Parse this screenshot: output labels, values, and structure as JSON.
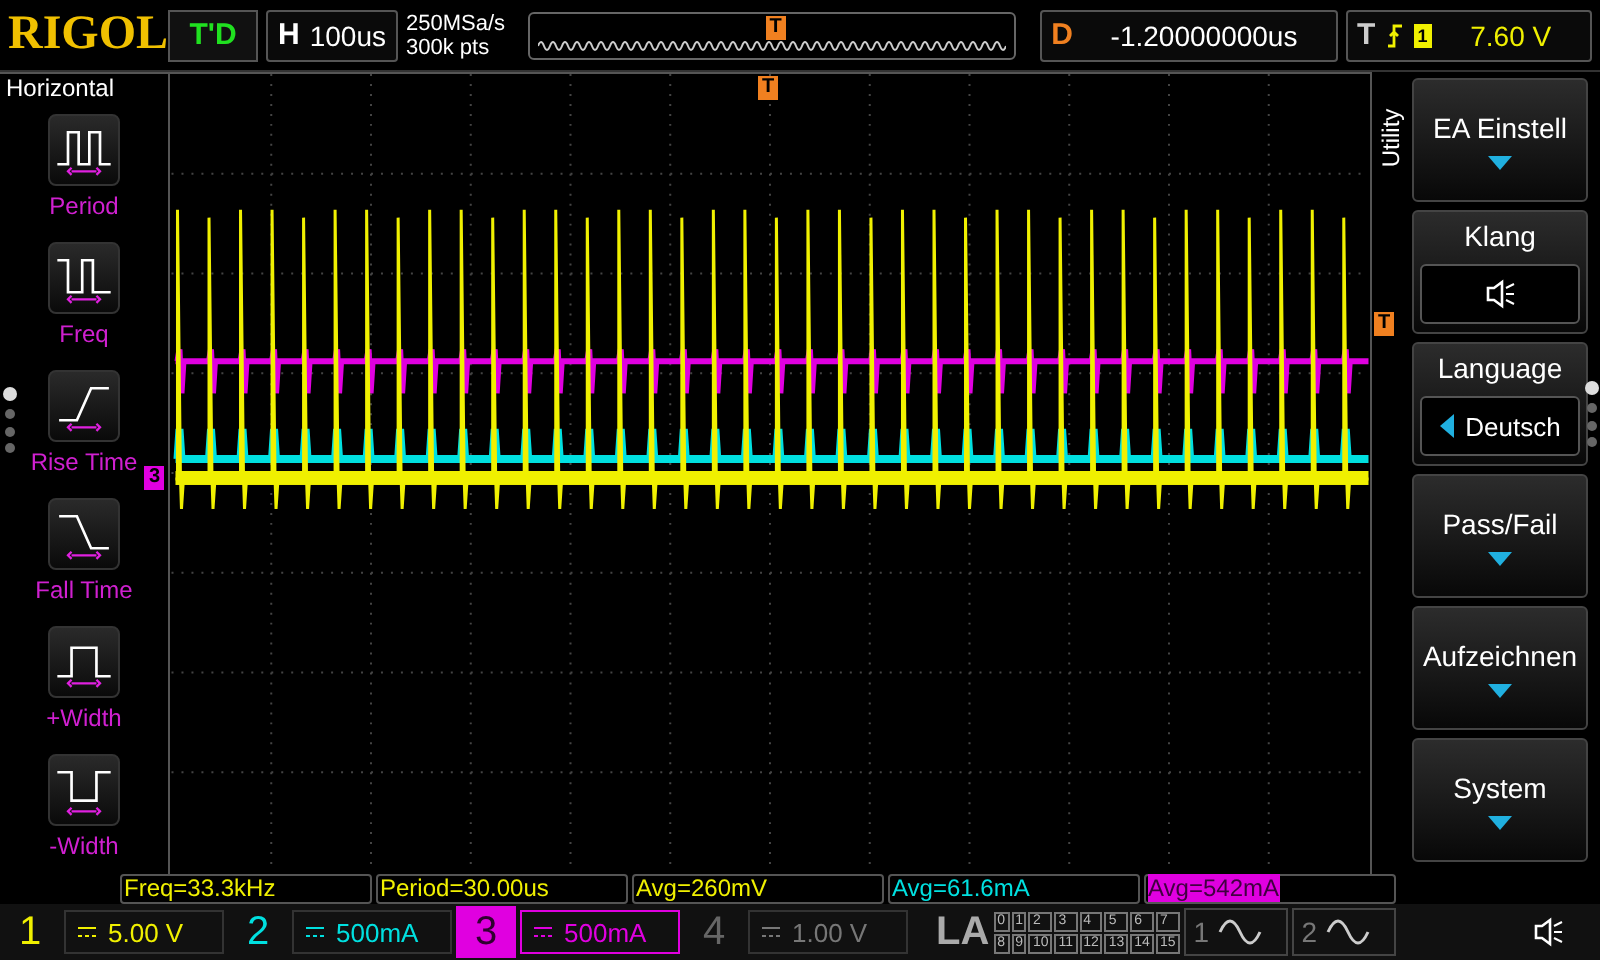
{
  "top_bar": {
    "logo": "RIGOL",
    "run_status": "T'D",
    "horizontal": {
      "label": "H",
      "value": "100us"
    },
    "sample_rate": "250MSa/s",
    "memory_depth": "300k pts",
    "delay": {
      "label": "D",
      "value": "-1.20000000us"
    },
    "trigger": {
      "label": "T",
      "source": "1",
      "level": "7.60 V"
    }
  },
  "left_menu": {
    "title": "Horizontal",
    "items": [
      {
        "kind": "period",
        "label": "Period"
      },
      {
        "kind": "freq",
        "label": "Freq"
      },
      {
        "kind": "rise",
        "label": "Rise Time"
      },
      {
        "kind": "fall",
        "label": "Fall Time"
      },
      {
        "kind": "pwidth",
        "label": "+Width"
      },
      {
        "kind": "nwidth",
        "label": "-Width"
      }
    ]
  },
  "markers": {
    "memory_trigger": "T",
    "trigger_position": "T",
    "channel": "3",
    "trigger_level": "T"
  },
  "right_menu": {
    "tab": "Utility",
    "items": [
      {
        "kind": "submenu",
        "label": "EA Einstell"
      },
      {
        "kind": "sound",
        "label": "Klang"
      },
      {
        "kind": "choice",
        "label": "Language",
        "value": "Deutsch"
      },
      {
        "kind": "submenu",
        "label": "Pass/Fail"
      },
      {
        "kind": "submenu",
        "label": "Aufzeichnen"
      },
      {
        "kind": "submenu",
        "label": "System"
      }
    ]
  },
  "measurements": [
    {
      "text": "Freq=33.3kHz",
      "color": "#f0f000",
      "highlighted": false
    },
    {
      "text": "Period=30.00us",
      "color": "#f0f000",
      "highlighted": false
    },
    {
      "text": "Avg=260mV",
      "color": "#f0f000",
      "highlighted": false
    },
    {
      "text": "Avg=61.6mA",
      "color": "#00e0e0",
      "highlighted": false
    },
    {
      "text": "Avg=542mA",
      "color": "#e000e0",
      "highlighted": true
    }
  ],
  "channels": [
    {
      "number": "1",
      "scale": "5.00 V",
      "color": "#f0f000",
      "on": true,
      "selected": false
    },
    {
      "number": "2",
      "scale": "500mA",
      "color": "#00e0e0",
      "on": true,
      "selected": false
    },
    {
      "number": "3",
      "scale": "500mA",
      "color": "#e000e0",
      "on": true,
      "selected": true
    },
    {
      "number": "4",
      "scale": "1.00 V",
      "color": "#666666",
      "on": false,
      "selected": false
    }
  ],
  "logic_analyzer": {
    "label": "LA",
    "bits": [
      "0",
      "1",
      "2",
      "3",
      "4",
      "5",
      "6",
      "7",
      "8",
      "9",
      "10",
      "11",
      "12",
      "13",
      "14",
      "15"
    ]
  },
  "math": [
    "1",
    "2"
  ]
}
